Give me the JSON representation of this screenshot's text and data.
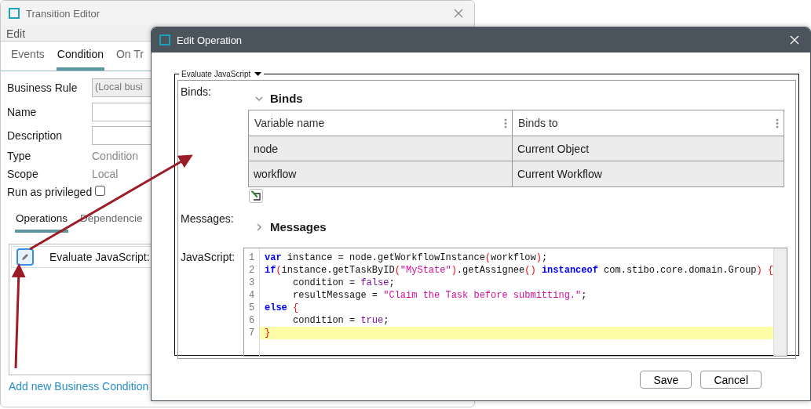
{
  "back_window": {
    "title": "Transition Editor",
    "menu": [
      "Edit"
    ],
    "tabs": [
      {
        "label": "Events",
        "selected": false
      },
      {
        "label": "Condition",
        "selected": true
      },
      {
        "label": "On Tr",
        "selected": false
      }
    ],
    "form": [
      {
        "kind": "select",
        "label": "Business Rule",
        "value": "(Local busi"
      },
      {
        "kind": "input",
        "label": "Name"
      },
      {
        "kind": "input",
        "label": "Description"
      },
      {
        "kind": "text",
        "label": "Type",
        "value": "Condition"
      },
      {
        "kind": "text",
        "label": "Scope",
        "value": "Local"
      },
      {
        "kind": "checkbox",
        "label": "Run as privileged",
        "checked": false
      }
    ],
    "subtabs": [
      {
        "label": "Operations",
        "selected": true
      },
      {
        "label": "Dependencie",
        "selected": false
      }
    ],
    "operations": [
      {
        "label": "Evaluate JavaScript: "
      }
    ],
    "add_link": "Add new Business Condition"
  },
  "dialog": {
    "title": "Edit Operation",
    "group_title": "Evaluate JavaScript",
    "binds": {
      "label": "Binds:",
      "header": "Binds",
      "expanded": true,
      "columns": [
        "Variable name",
        "Binds to"
      ],
      "rows": [
        [
          "node",
          "Current Object"
        ],
        [
          "workflow",
          "Current Workflow"
        ]
      ]
    },
    "messages": {
      "label": "Messages:",
      "header": "Messages",
      "expanded": false
    },
    "javascript": {
      "label": "JavaScript:",
      "lines": [
        {
          "number": "1",
          "highlighted": false,
          "tokens": [
            {
              "kind": "keyword",
              "text": "var"
            },
            {
              "kind": "plain",
              "text": " instance = node.getWorkflowInstance"
            },
            {
              "kind": "bracket",
              "text": "("
            },
            {
              "kind": "plain",
              "text": "workflow"
            },
            {
              "kind": "bracket",
              "text": ")"
            },
            {
              "kind": "plain",
              "text": ";"
            }
          ]
        },
        {
          "number": "2",
          "highlighted": false,
          "tokens": [
            {
              "kind": "keyword",
              "text": "if"
            },
            {
              "kind": "bracket",
              "text": "("
            },
            {
              "kind": "plain",
              "text": "instance.getTaskByID"
            },
            {
              "kind": "bracket",
              "text": "("
            },
            {
              "kind": "string",
              "text": "\"MyState\""
            },
            {
              "kind": "bracket",
              "text": ")"
            },
            {
              "kind": "plain",
              "text": ".getAssignee"
            },
            {
              "kind": "bracket",
              "text": "() "
            },
            {
              "kind": "keyword",
              "text": "instanceof"
            },
            {
              "kind": "plain",
              "text": " com.stibo.core.domain.Group"
            },
            {
              "kind": "bracket",
              "text": ") {"
            }
          ]
        },
        {
          "number": "3",
          "highlighted": false,
          "tokens": [
            {
              "kind": "plain",
              "text": "     condition = "
            },
            {
              "kind": "literal",
              "text": "false"
            },
            {
              "kind": "plain",
              "text": ";"
            }
          ]
        },
        {
          "number": "4",
          "highlighted": false,
          "tokens": [
            {
              "kind": "plain",
              "text": "     resultMessage = "
            },
            {
              "kind": "string",
              "text": "\"Claim the Task before submitting.\""
            },
            {
              "kind": "plain",
              "text": ";"
            }
          ]
        },
        {
          "number": "5",
          "highlighted": false,
          "tokens": [
            {
              "kind": "keyword",
              "text": "else"
            },
            {
              "kind": "bracket",
              "text": " {"
            }
          ]
        },
        {
          "number": "6",
          "highlighted": false,
          "tokens": [
            {
              "kind": "plain",
              "text": "     condition = "
            },
            {
              "kind": "literal",
              "text": "true"
            },
            {
              "kind": "plain",
              "text": ";"
            }
          ]
        },
        {
          "number": "7",
          "highlighted": true,
          "tokens": [
            {
              "kind": "bracket",
              "text": "}"
            }
          ]
        }
      ]
    },
    "buttons": [
      "Save",
      "Cancel"
    ]
  }
}
